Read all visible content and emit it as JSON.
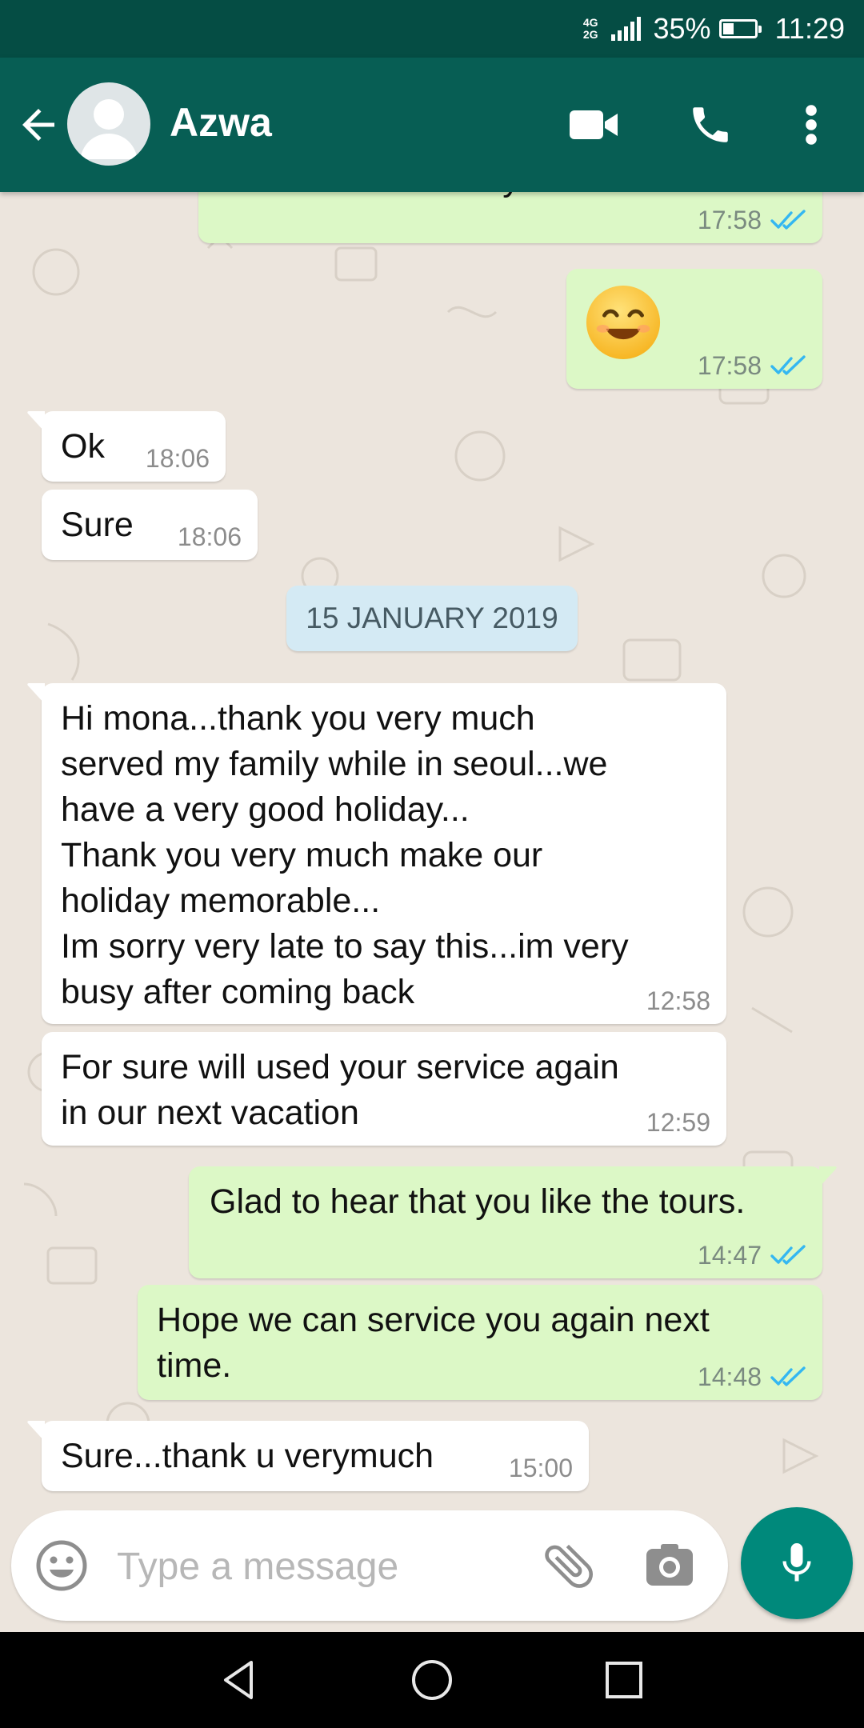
{
  "status_bar": {
    "network_type": "4G",
    "network_type_2": "2G",
    "battery_percent": "35%",
    "battery_level": 0.35,
    "time": "11:29"
  },
  "header": {
    "contact_name": "Azwa",
    "icons": [
      "back-arrow-icon",
      "avatar",
      "video-call-icon",
      "phone-icon",
      "more-vert-icon"
    ]
  },
  "chat": {
    "partial_message": {
      "text": "Glad to hear that you like the tours",
      "time": "17:58",
      "status": "read"
    },
    "emoji_message": {
      "emoji": "😊",
      "time": "17:58",
      "status": "read"
    },
    "messages_day1": [
      {
        "direction": "in",
        "text": "Ok",
        "time": "18:06"
      },
      {
        "direction": "in",
        "text": "Sure",
        "time": "18:06"
      }
    ],
    "date_separator": "15 JANUARY 2019",
    "messages_day2": [
      {
        "direction": "in",
        "text": "Hi mona...thank you very much\nserved my family while in seoul...we\nhave a very good holiday...\nThank you very much make our\nholiday memorable...\nIm sorry very late to say this...im very\nbusy after coming back",
        "time": "12:58"
      },
      {
        "direction": "in",
        "text": "For sure will used your service again\nin our next vacation",
        "time": "12:59"
      },
      {
        "direction": "out",
        "text": "Glad to hear that you like the tours.",
        "time": "14:47",
        "status": "read"
      },
      {
        "direction": "out",
        "text": "Hope we can service you again next\ntime.",
        "time": "14:48",
        "status": "read"
      },
      {
        "direction": "in",
        "text": "Sure...thank u verymuch",
        "time": "15:00"
      }
    ]
  },
  "input_bar": {
    "placeholder": "Type a message",
    "icons": [
      "emoji-icon",
      "attach-icon",
      "camera-icon",
      "mic-icon"
    ]
  },
  "colors": {
    "status_bar": "#054d44",
    "header": "#075e54",
    "chat_background": "#ece5dd",
    "outgoing_bubble": "#dcf8c6",
    "incoming_bubble": "#ffffff",
    "date_chip": "#d4eaf4",
    "read_tick": "#34b7f1",
    "mic_button": "#00897b"
  },
  "nav_bar": {
    "icons": [
      "back-triangle-icon",
      "home-circle-icon",
      "recents-square-icon"
    ]
  }
}
